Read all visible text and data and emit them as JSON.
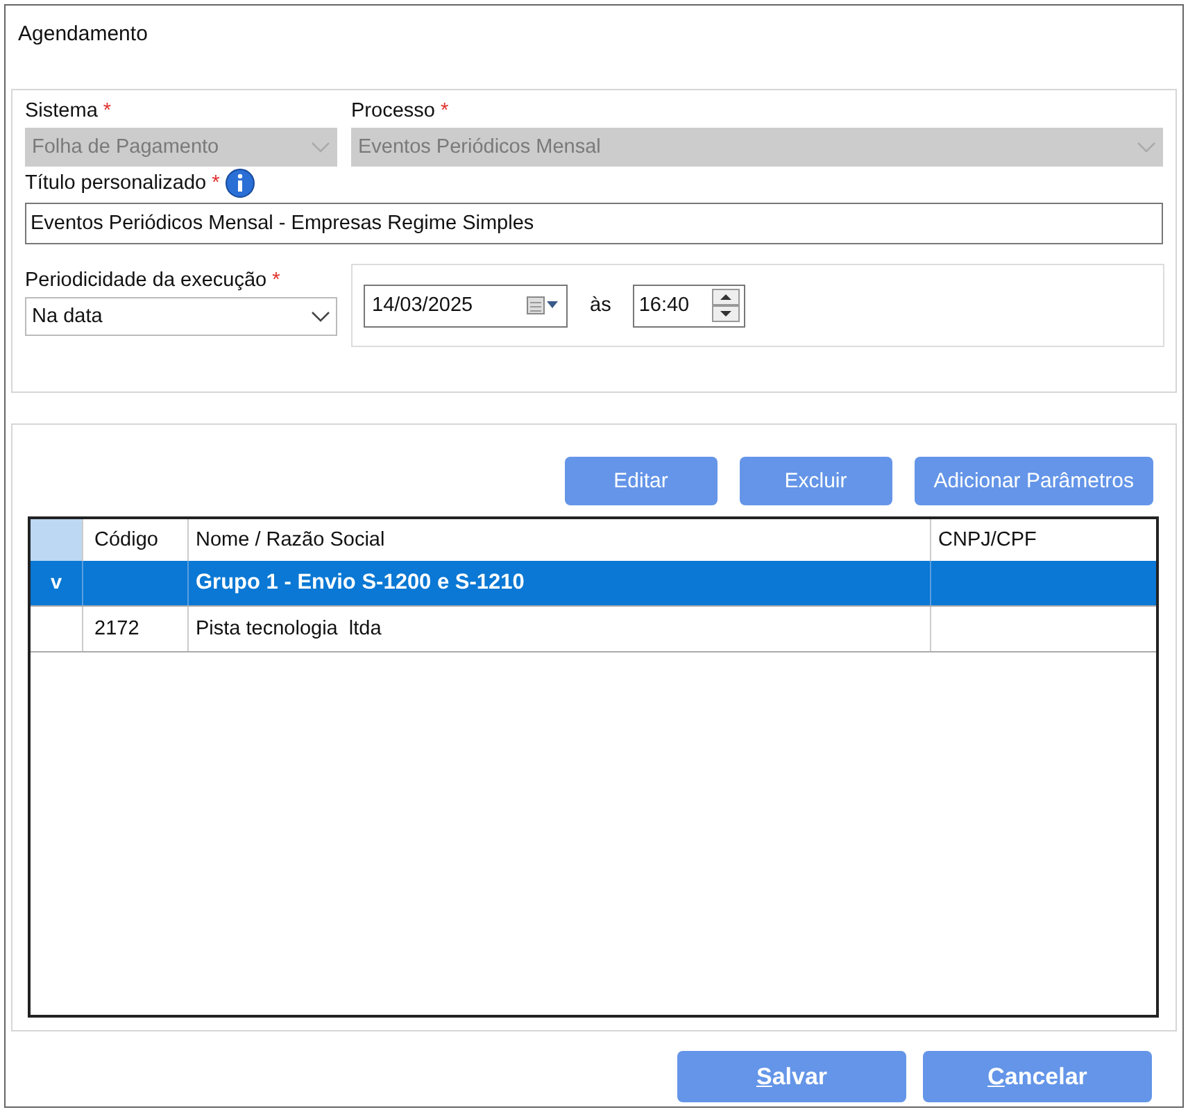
{
  "window": {
    "title": "Agendamento"
  },
  "form": {
    "sistema": {
      "label": "Sistema",
      "required_mark": "*",
      "value": "Folha de Pagamento",
      "disabled": true
    },
    "processo": {
      "label": "Processo",
      "required_mark": "*",
      "value": "Eventos Periódicos Mensal",
      "disabled": true
    },
    "titulo": {
      "label": "Título personalizado",
      "required_mark": "*",
      "value": "Eventos Periódicos Mensal - Empresas Regime Simples"
    },
    "periodicidade": {
      "label": "Periodicidade da execução",
      "required_mark": "*",
      "value": "Na data",
      "disabled": false
    },
    "date": "14/03/2025",
    "as_label": "às",
    "time": "16:40"
  },
  "actions": [
    {
      "label": "Editar"
    },
    {
      "label": "Excluir"
    },
    {
      "label": "Adicionar Parâmetros"
    }
  ],
  "table": {
    "columns": [
      "",
      "Código",
      "Nome / Razão Social",
      "CNPJ/CPF"
    ],
    "rows": [
      {
        "kind": "group",
        "selected": true,
        "marker": "v",
        "code": "",
        "name": "Grupo 1 - Envio S-1200 e S-1210"
      },
      {
        "kind": "item",
        "selected": false,
        "marker": "",
        "code": "2172",
        "name": "Pista tecnologia  ltda"
      }
    ]
  },
  "buttons": [
    {
      "label": "Salvar",
      "mnemonic": true
    },
    {
      "label": "Cancelar",
      "mnemonic": true
    }
  ]
}
